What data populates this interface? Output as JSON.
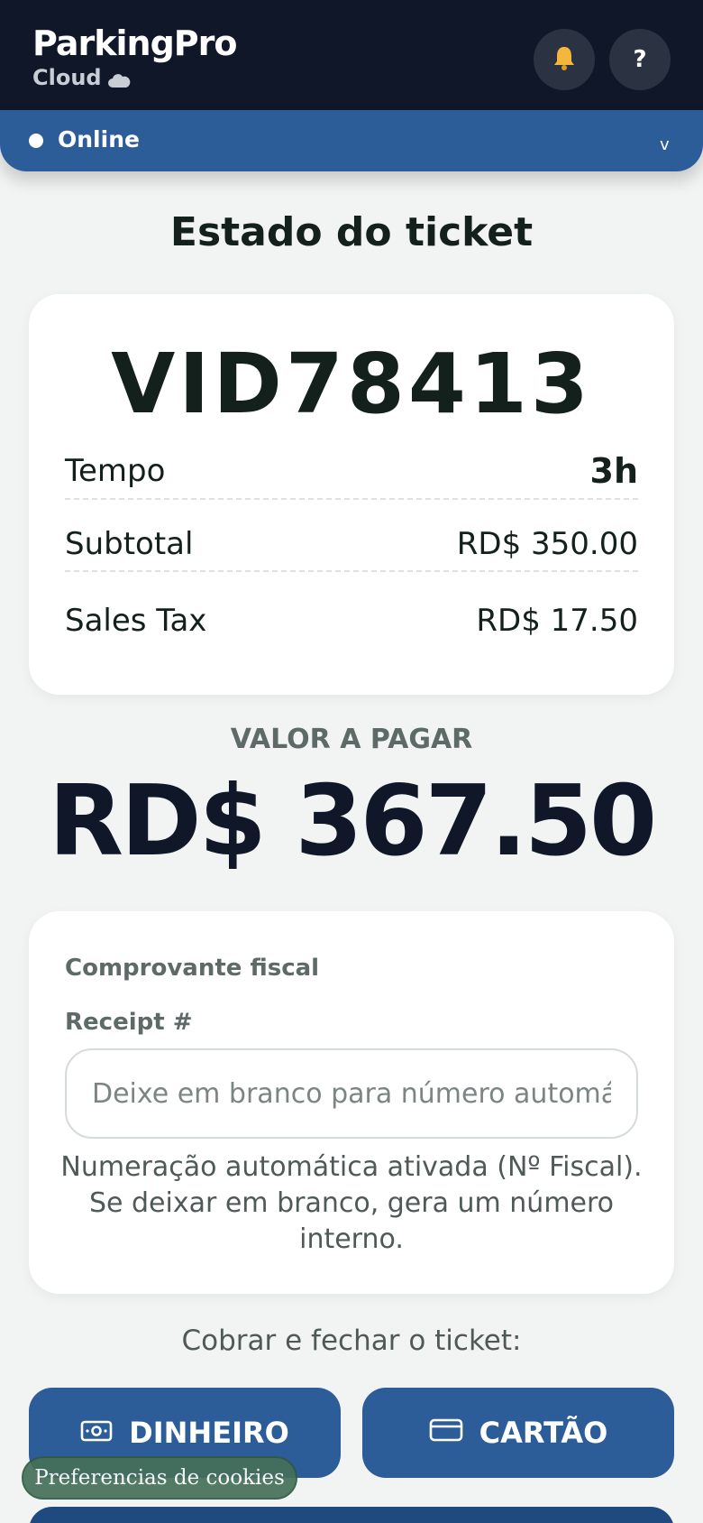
{
  "header": {
    "brand": "ParkingPro",
    "sub": "Cloud",
    "icons": {
      "notifications": "bell-icon",
      "help": "help-icon",
      "cloud": "cloud-icon"
    },
    "help_label": "?"
  },
  "status": {
    "label": "Online",
    "chevron": "v"
  },
  "page": {
    "title": "Estado do ticket"
  },
  "ticket": {
    "id": "VID78413",
    "rows": [
      {
        "label": "Tempo",
        "value": "3h"
      },
      {
        "label": "Subtotal",
        "value": "RD$ 350.00"
      },
      {
        "label": "Sales Tax",
        "value": "RD$ 17.50"
      }
    ]
  },
  "amount": {
    "label": "VALOR A PAGAR",
    "value": "RD$ 367.50"
  },
  "receipt": {
    "section_label": "Comprovante fiscal",
    "field_label": "Receipt #",
    "placeholder": "Deixe em branco para número automático",
    "help": "Numeração automática ativada (Nº Fiscal). Se deixar em branco, gera um número interno."
  },
  "charge": {
    "label": "Cobrar e fechar o ticket:",
    "cash_label": "DINHEIRO",
    "card_label": "CARTÃO",
    "cash_icon": "cash-icon",
    "card_icon": "credit-card-icon"
  },
  "cookies": {
    "label": "Preferencias de cookies"
  },
  "colors": {
    "header_bg": "#0f1729",
    "accent": "#2d5d98",
    "background": "#f1f4f3",
    "cookie_bg": "#45705a"
  }
}
